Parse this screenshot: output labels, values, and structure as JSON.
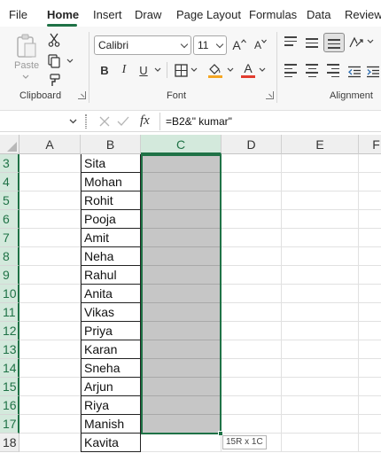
{
  "menu": {
    "tabs": [
      {
        "label": "File"
      },
      {
        "label": "Home"
      },
      {
        "label": "Insert"
      },
      {
        "label": "Draw"
      },
      {
        "label": "Page Layout"
      },
      {
        "label": "Formulas"
      },
      {
        "label": "Data"
      },
      {
        "label": "Review"
      }
    ],
    "active_tab": "Home"
  },
  "ribbon": {
    "clipboard": {
      "label": "Clipboard",
      "paste_label": "Paste"
    },
    "font": {
      "label": "Font",
      "font_name": "Calibri",
      "font_size": "11",
      "bold": "B",
      "italic": "I",
      "underline": "U",
      "grow": "A",
      "shrink": "A",
      "font_color_glyph": "A",
      "font_color": "#e23c2f",
      "fill_color": "#f5a623"
    },
    "alignment": {
      "label": "Alignment"
    }
  },
  "formula_bar": {
    "name_box_value": "",
    "fx": "fx",
    "formula": "=B2&\" kumar\""
  },
  "grid": {
    "columns": [
      "A",
      "B",
      "C",
      "D",
      "E",
      "F"
    ],
    "selected_column": "C",
    "rows": [
      {
        "num": "3",
        "b": "Sita"
      },
      {
        "num": "4",
        "b": "Mohan"
      },
      {
        "num": "5",
        "b": "Rohit"
      },
      {
        "num": "6",
        "b": "Pooja"
      },
      {
        "num": "7",
        "b": "Amit"
      },
      {
        "num": "8",
        "b": "Neha"
      },
      {
        "num": "9",
        "b": "Rahul"
      },
      {
        "num": "10",
        "b": "Anita"
      },
      {
        "num": "11",
        "b": "Vikas"
      },
      {
        "num": "12",
        "b": "Priya"
      },
      {
        "num": "13",
        "b": "Karan"
      },
      {
        "num": "14",
        "b": "Sneha"
      },
      {
        "num": "15",
        "b": "Arjun"
      },
      {
        "num": "16",
        "b": "Riya"
      },
      {
        "num": "17",
        "b": "Manish"
      },
      {
        "num": "18",
        "b": "Kavita"
      }
    ],
    "selection_tooltip": "15R x 1C",
    "accent_color": "#1f7246"
  }
}
